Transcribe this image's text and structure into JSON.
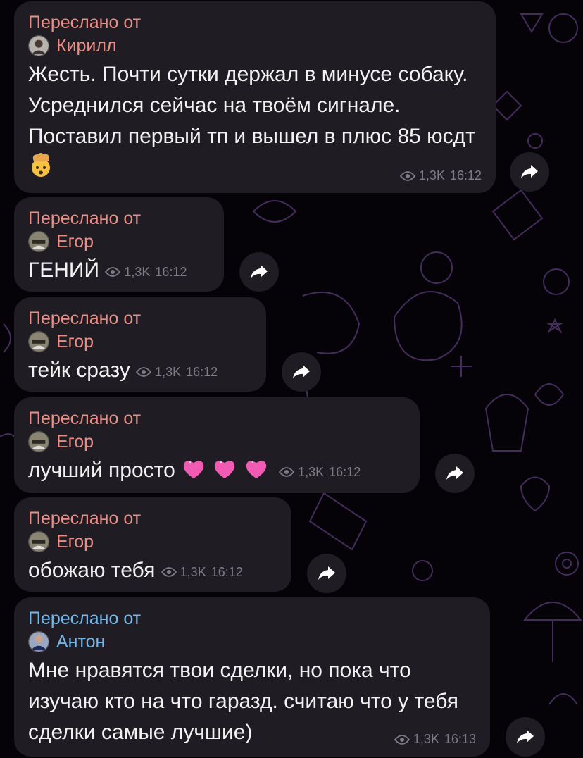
{
  "forwarded_label": "Переслано от",
  "messages": [
    {
      "author": "Кирилл",
      "author_color": "#e78f86",
      "text": "Жесть. Почти сутки держал в минусе собаку. Усреднился сейчас на твоём сигнале. Поставил первый тп и вышел в плюс 85 юсдт",
      "emoji": "exploding-head-emoji",
      "views": "1,3K",
      "time": "16:12"
    },
    {
      "author": "Егор",
      "author_color": "#e78f86",
      "text": "ГЕНИЙ",
      "views": "1,3K",
      "time": "16:12"
    },
    {
      "author": "Егор",
      "author_color": "#e78f86",
      "text": "тейк сразу",
      "views": "1,3K",
      "time": "16:12"
    },
    {
      "author": "Егор",
      "author_color": "#e78f86",
      "text": "лучший просто",
      "emoji": "sparkling-heart-emoji",
      "views": "1,3K",
      "time": "16:12"
    },
    {
      "author": "Егор",
      "author_color": "#e78f86",
      "text": "обожаю тебя",
      "views": "1,3K",
      "time": "16:12"
    },
    {
      "author": "Антон",
      "author_color": "#73b6e7",
      "text": "Мне нравятся твои сделки, но пока что изучаю кто на что гаразд. считаю что у тебя сделки самые лучшие)",
      "views": "1,3K",
      "time": "16:13"
    }
  ],
  "icons": {
    "views": "eye-icon",
    "share": "share-arrow-icon"
  },
  "colors": {
    "background": "#050308",
    "bubble": "#1f1c23",
    "meta_text": "#7f7b84",
    "doodle": "#5a3a78"
  }
}
